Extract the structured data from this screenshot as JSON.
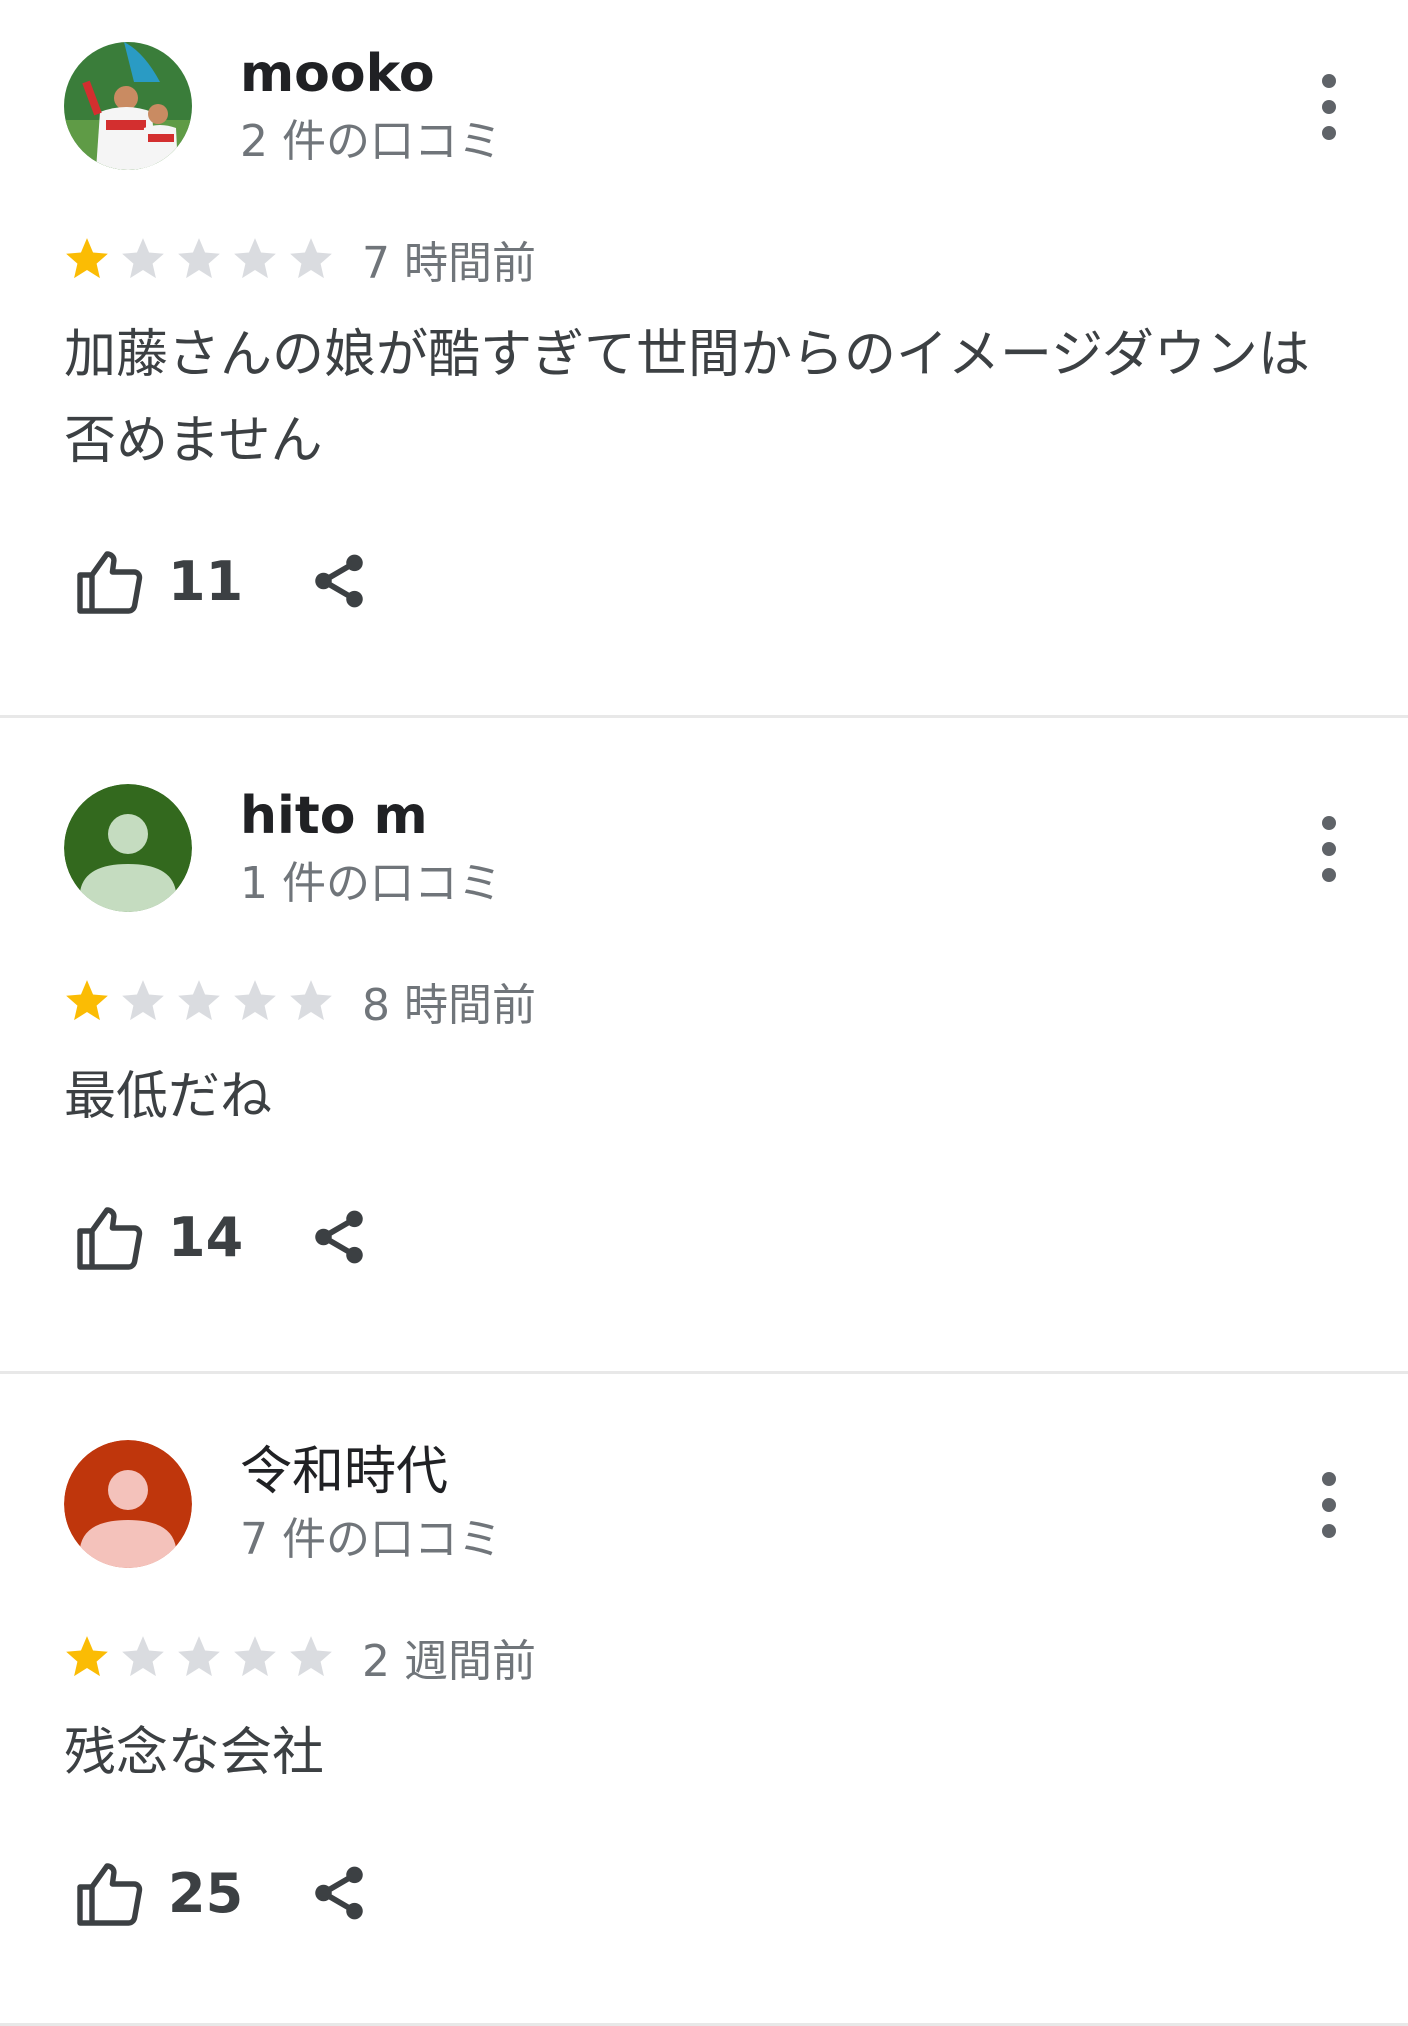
{
  "reviews": [
    {
      "author": "mooko",
      "review_count": "2 件の口コミ",
      "avatar": {
        "type": "photo",
        "color": "#2e7d32"
      },
      "rating": 1,
      "max_rating": 5,
      "time": "7 時間前",
      "text": "加藤さんの娘が酷すぎて世間からのイメージダウンは否めません",
      "likes": "11"
    },
    {
      "author": "hito m",
      "review_count": "1 件の口コミ",
      "avatar": {
        "type": "placeholder",
        "color": "#33691e"
      },
      "rating": 1,
      "max_rating": 5,
      "time": "8 時間前",
      "text": "最低だね",
      "likes": "14"
    },
    {
      "author": "令和時代",
      "review_count": "7 件の口コミ",
      "avatar": {
        "type": "placeholder",
        "color": "#bf360c"
      },
      "rating": 1,
      "max_rating": 5,
      "time": "2 週間前",
      "text": "残念な会社",
      "likes": "25"
    }
  ],
  "colors": {
    "star_filled": "#fbbc04",
    "star_empty": "#dadce0",
    "muted_text": "#70757a",
    "icon": "#3c4043"
  },
  "icons": {
    "like": "thumbs-up-icon",
    "share": "share-icon",
    "menu": "more-vert-icon"
  }
}
